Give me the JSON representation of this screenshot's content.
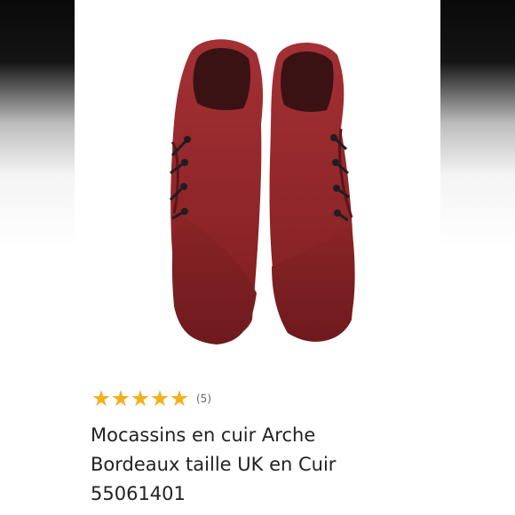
{
  "product": {
    "image": {
      "alt": "Mocassins en cuir Arche Bordeaux",
      "color": "#8f2a2c"
    },
    "rating": {
      "stars": 5,
      "max": 5,
      "review_count": "(5)",
      "star_color": "#f2b01e"
    },
    "title_line1": "Mocassins en cuir Arche",
    "title_line2": "Bordeaux taille UK en Cuir",
    "title_line3": "55061401"
  }
}
